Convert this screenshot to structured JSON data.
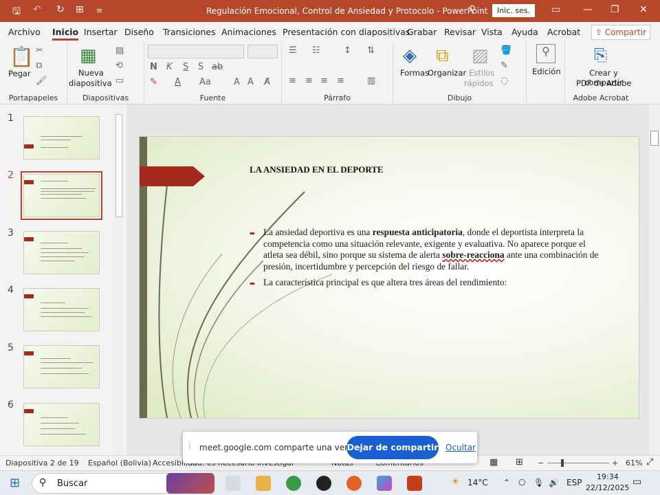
{
  "titlebar": {
    "title": "Regulación Emocional, Control de Ansiedad y Protocolo  -  PowerPoint",
    "signin": "Inic. ses."
  },
  "menu": {
    "tabs": [
      "Archivo",
      "Inicio",
      "Insertar",
      "Diseño",
      "Transiciones",
      "Animaciones",
      "Presentación con diapositivas",
      "Grabar",
      "Revisar",
      "Vista",
      "Ayuda",
      "Acrobat"
    ],
    "share": "Compartir"
  },
  "ribbon": {
    "paste": "Pegar",
    "new_slide_1": "Nueva",
    "new_slide_2": "diapositiva",
    "font_bold": "N",
    "font_italic": "K",
    "font_underline": "S",
    "font_shadow": "S",
    "font_strike": "ab",
    "font_case": "Aa",
    "shapes": "Formas",
    "arrange": "Organizar",
    "styles_1": "Estilos",
    "styles_2": "rápidos",
    "edit": "Edición",
    "adobe_1": "Crear y compartir",
    "adobe_2": "PDF de Adobe",
    "groups": [
      "Portapapeles",
      "Diapositivas",
      "Fuente",
      "Párrafo",
      "Dibujo",
      "Adobe Acrobat"
    ]
  },
  "thumbnails": [
    {
      "num": "1"
    },
    {
      "num": "2"
    },
    {
      "num": "3"
    },
    {
      "num": "4"
    },
    {
      "num": "5"
    },
    {
      "num": "6"
    }
  ],
  "slide": {
    "title": "LA ANSIEDAD EN EL DEPORTE",
    "b1_a": "La ansiedad deportiva es una ",
    "b1_bold": "respuesta anticipatoria",
    "b1_b": ", donde el deportista interpreta la competencia como una situación relevante, exigente y evaluativa. No aparece porque el atleta sea débil, sino porque su sistema de alerta ",
    "b1_bold2": "sobre-reacciona",
    "b1_c": " ante una combinación de presión, incertidumbre y percepción del riesgo de fallar.",
    "b2": "La característica principal es que altera tres áreas del rendimiento:"
  },
  "share_notification": {
    "text": "meet.google.com comparte una ventana.",
    "stop": "Dejar de compartir",
    "hide": "Ocultar"
  },
  "status": {
    "slide": "Diapositiva 2 de 19",
    "lang": "Español (Bolivia)",
    "access": "Accesibilidad: es necesario investigar",
    "notes": "Notas",
    "comments": "Comentarios",
    "zoom": "61%"
  },
  "taskbar": {
    "search": "Buscar",
    "weather": "14°C",
    "lang": "ESP",
    "time": "19:34",
    "date": "22/12/2025"
  }
}
